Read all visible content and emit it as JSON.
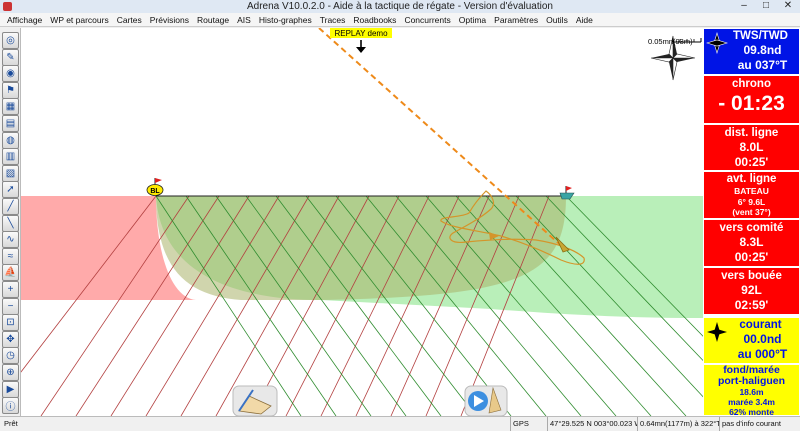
{
  "window": {
    "title": "Adrena V10.0.2.0 - Aide à la tactique de régate - Version d'évaluation",
    "minimize": "–",
    "maximize": "□",
    "close": "✕"
  },
  "menu": [
    "Affichage",
    "WP et parcours",
    "Cartes",
    "Prévisions",
    "Routage",
    "AIS",
    "Histo-graphes",
    "Traces",
    "Roadbooks",
    "Concurrents",
    "Optima",
    "Paramètres",
    "Outils",
    "Aide"
  ],
  "toolbar_icons": [
    "lifebuoy-icon",
    "measure-icon",
    "compass-icon",
    "mark-icon",
    "chart-icon",
    "table-icon",
    "polar-icon",
    "stats-icon",
    "graph-icon",
    "route-icon",
    "layline-icon",
    "laylines2-icon",
    "tracks-icon",
    "wind-icon",
    "boat-icon",
    "zoom-in-icon",
    "zoom-out-icon",
    "zoom-fit-icon",
    "pan-icon",
    "clock-icon",
    "center-icon",
    "replay-icon",
    "info-icon"
  ],
  "map": {
    "replay_label": "REPLAY demo",
    "mark_label": "BL",
    "scale_label": "0.05mn(93m)"
  },
  "panels": {
    "tws": {
      "title": "TWS/TWD",
      "line1": "09.8nd",
      "line2": "au 037°T",
      "color": "#0014e6"
    },
    "chrono": {
      "title": "chrono",
      "value": "- 01:23",
      "color": "#ff0000"
    },
    "dist": {
      "title": "dist. ligne",
      "line1": "8.0L",
      "line2": "00:25'",
      "color": "#ff0000"
    },
    "avt": {
      "title": "avt. ligne",
      "line1": "BATEAU",
      "line2": "6° 9.6L",
      "line3": "(vent 37°)",
      "color": "#ff0000"
    },
    "comite": {
      "title": "vers comité",
      "line1": "8.3L",
      "line2": "00:25'",
      "color": "#ff0000"
    },
    "bouee": {
      "title": "vers bouée",
      "line1": "92L",
      "line2": "02:59'",
      "color": "#ff0000"
    },
    "courant": {
      "title": "courant",
      "line1": "00.0nd",
      "line2": "au 000°T",
      "color": "#ffff00"
    },
    "maree": {
      "title1": "fond/marée",
      "title2": "port-haliguen",
      "line1": "18.6m",
      "line2": "marée 3.4m",
      "line3": "62% monte",
      "color": "#ffff00"
    }
  },
  "status": {
    "state": "Prêt",
    "gps": "GPS",
    "position": "47°29.525 N 003°00.023 W",
    "distance": "0.64mn(1177m) à 322°T du B",
    "current_info": "pas d'info courant"
  }
}
